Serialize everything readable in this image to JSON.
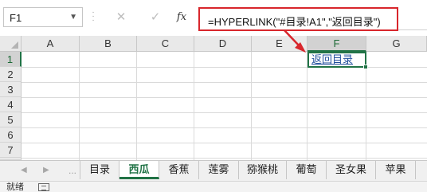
{
  "name_box": {
    "value": "F1"
  },
  "formula_bar": {
    "cancel_glyph": "✕",
    "enter_glyph": "✓",
    "fx_label": "fx",
    "formula": "=HYPERLINK(\"#目录!A1\",\"返回目录\")"
  },
  "columns": [
    "A",
    "B",
    "C",
    "D",
    "E",
    "F",
    "G"
  ],
  "selected_column": "F",
  "rows": [
    "1",
    "2",
    "3",
    "4",
    "5",
    "6",
    "7"
  ],
  "selected_row": "1",
  "cells": {
    "F1": "返回目录"
  },
  "sheet_tabs": [
    "目录",
    "西瓜",
    "香蕉",
    "莲雾",
    "猕猴桃",
    "葡萄",
    "圣女果",
    "苹果"
  ],
  "active_sheet": "西瓜",
  "tab_nav": {
    "prev": "◀",
    "next": "▶",
    "ellipsis": "..."
  },
  "status_bar": {
    "text": "就绪"
  },
  "colors": {
    "accent": "#217346",
    "annotation": "#d8262c",
    "link": "#1f4e9c"
  }
}
